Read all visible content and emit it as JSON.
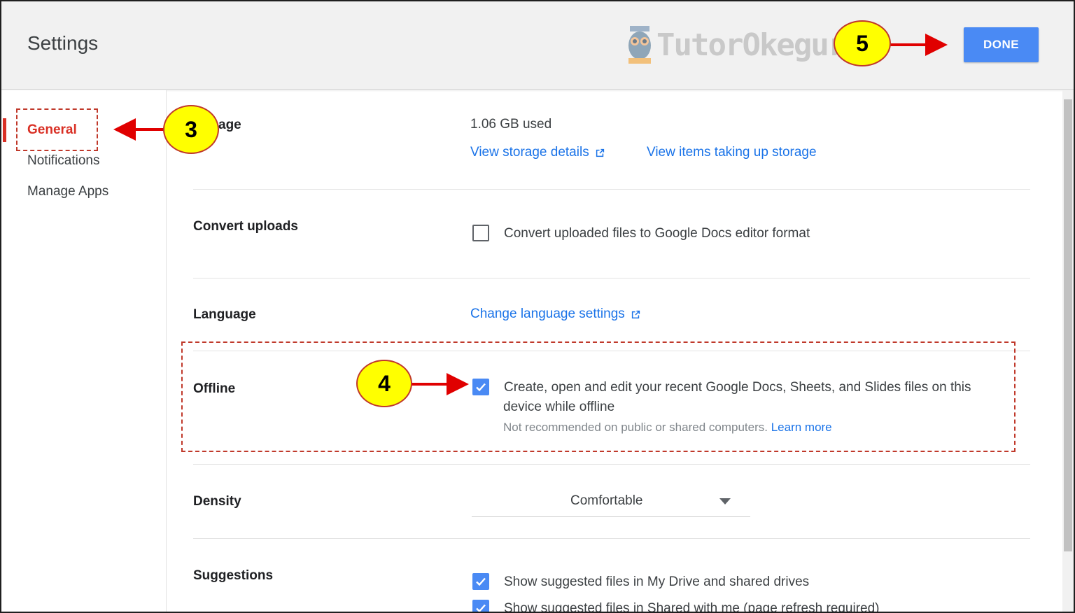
{
  "header": {
    "title": "Settings",
    "watermark": "TutorOkeguru",
    "done_label": "DONE"
  },
  "sidebar": {
    "items": [
      {
        "label": "General",
        "active": true
      },
      {
        "label": "Notifications",
        "active": false
      },
      {
        "label": "Manage Apps",
        "active": false
      }
    ]
  },
  "storage": {
    "label_partial": "age",
    "used": "1.06 GB used",
    "link_details": "View storage details",
    "link_items": "View items taking up storage"
  },
  "convert_uploads": {
    "label": "Convert uploads",
    "checkbox_label": "Convert uploaded files to Google Docs editor format",
    "checked": false
  },
  "language": {
    "label": "Language",
    "link": "Change language settings"
  },
  "offline": {
    "label": "Offline",
    "checkbox_line1": "Create, open and edit your recent Google Docs, Sheets, and Slides files on this",
    "checkbox_line2": "device while offline",
    "note": "Not recommended on public or shared computers.",
    "learn_more": "Learn more",
    "checked": true
  },
  "density": {
    "label": "Density",
    "value": "Comfortable"
  },
  "suggestions": {
    "label": "Suggestions",
    "item1": "Show suggested files in My Drive and shared drives",
    "item2": "Show suggested files in Shared with me (page refresh required)",
    "item1_checked": true,
    "item2_checked": true
  },
  "annotations": {
    "step3": "3",
    "step4": "4",
    "step5": "5"
  },
  "colors": {
    "accent_blue": "#4a8af4",
    "link_blue": "#1a73e8",
    "active_red": "#d93025",
    "annotation_red": "#e00000",
    "badge_yellow": "#ffff00"
  }
}
